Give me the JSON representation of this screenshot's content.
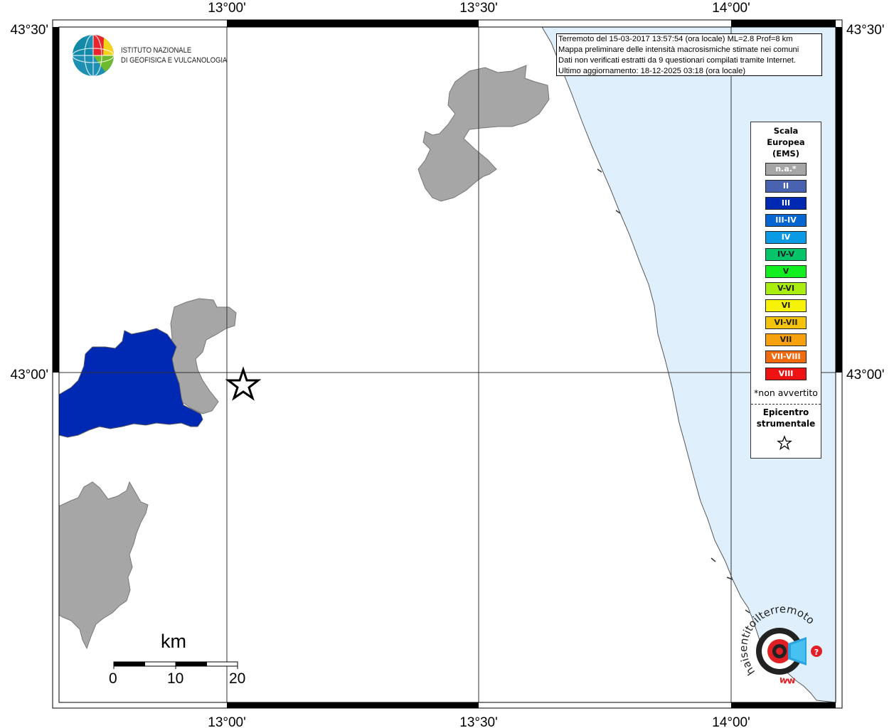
{
  "map": {
    "info_lines": [
      "Terremoto del 15-03-2017 13:57:54 (ora locale) ML=2.8 Prof=8 km",
      "Mappa preliminare delle intensità macrosismiche stimate nei comuni",
      "Dati non verificati estratti da 9 questionari compilati tramite Internet.",
      "Ultimo aggiornamento: 18-12-2025 03:18 (ora locale)"
    ],
    "coords": {
      "lon_1300": "13°00'",
      "lon_1330": "13°30'",
      "lon_1400": "14°00'",
      "lat_4330": "43°30'",
      "lat_4300": "43°00'"
    },
    "logo_ingv": {
      "line1": "ISTITUTO NAZIONALE",
      "line2": "DI GEOFISICA E VULCANOLOGIA"
    },
    "scale_bar": {
      "unit": "km",
      "ticks": [
        "0",
        "10",
        "20"
      ]
    },
    "legend": {
      "title_lines": [
        "Scala",
        "Europea",
        "(EMS)"
      ],
      "items": [
        {
          "label": "n.a.*",
          "color": "#a6a6a6"
        },
        {
          "label": "II",
          "color": "#4a63b0"
        },
        {
          "label": "III",
          "color": "#0029b3"
        },
        {
          "label": "III-IV",
          "color": "#0566d2"
        },
        {
          "label": "IV",
          "color": "#0b9be6"
        },
        {
          "label": "IV-V",
          "color": "#06c46a"
        },
        {
          "label": "V",
          "color": "#12ee1f"
        },
        {
          "label": "V-VI",
          "color": "#aaee10"
        },
        {
          "label": "VI",
          "color": "#f6f308"
        },
        {
          "label": "VI-VII",
          "color": "#f4c40c"
        },
        {
          "label": "VII",
          "color": "#f7a10f"
        },
        {
          "label": "VII-VIII",
          "color": "#f26a0e"
        },
        {
          "label": "VIII",
          "color": "#ee1212"
        }
      ],
      "note": "*non avvertito",
      "epicenter_lines": [
        "Epicentro",
        "strumentale"
      ]
    },
    "hst_logo": {
      "text": "haisentitoilterremoto.it",
      "www": "www."
    },
    "colors": {
      "sea": "#dff0fc",
      "municipality_na": "#a6a6a6",
      "municipality_iii": "#0029b3"
    }
  }
}
